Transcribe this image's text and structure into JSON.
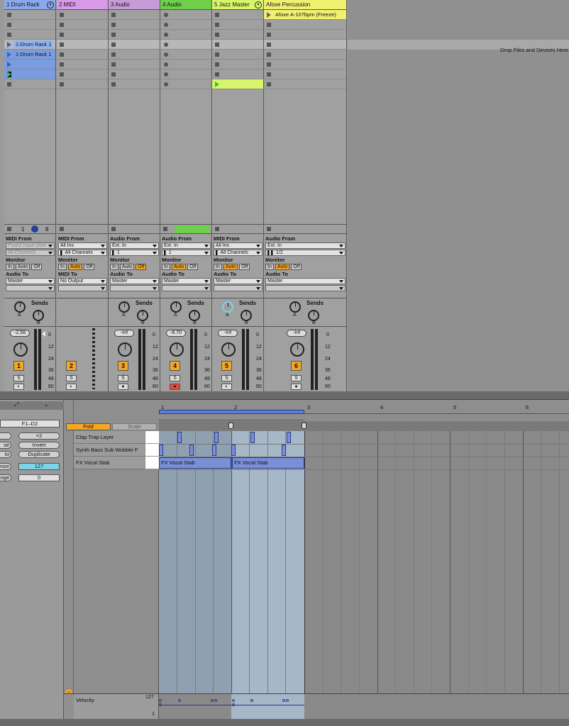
{
  "colors": {
    "drum_rack": "#8aa8ec",
    "midi": "#d69ae8",
    "audio3": "#c79ad8",
    "audio4": "#6fcf4a",
    "jazz": "#d8f56a",
    "afoxe": "#f0f070",
    "clip_selected": "#8fb3f0",
    "orange": "#f5a623",
    "record_red": "#e8473a"
  },
  "tracks": [
    {
      "name": "1 Drum Rack",
      "io_type": "MIDI From",
      "from": "Push2 Input (Ab▾",
      "channel": "All Channels",
      "monitor_active": "",
      "audio_to": "Master",
      "volume": "-2.58",
      "number": "1",
      "clips": [
        "1-Drum Rack 1",
        "1-Drum Rack 1"
      ],
      "bottom": [
        "1",
        "8"
      ]
    },
    {
      "name": "2 MIDI",
      "io_type": "MIDI From",
      "from": "All Ins",
      "channel": "All Channels",
      "monitor_active": "Auto",
      "audio_to_label": "MIDI To",
      "audio_to": "No Output",
      "volume": "",
      "number": "2"
    },
    {
      "name": "3 Audio",
      "io_type": "Audio From",
      "from": "Ext. In",
      "channel": "1",
      "monitor_active": "Off",
      "audio_to": "Master",
      "volume": "-Inf",
      "number": "3"
    },
    {
      "name": "4 Audio",
      "io_type": "Audio From",
      "from": "Ext. In",
      "channel": "1",
      "monitor_active": "Auto",
      "audio_to": "Master",
      "volume": "-8.70",
      "number": "4"
    },
    {
      "name": "5 Jazz Master",
      "io_type": "MIDI From",
      "from": "All Ins",
      "channel": "All Channels",
      "monitor_active": "Auto",
      "audio_to": "Master",
      "volume": "-Inf",
      "number": "5"
    },
    {
      "name": "Afoxe Percussion",
      "io_type": "Audio From",
      "from": "Ext. In",
      "channel": "1/2",
      "monitor_active": "Auto",
      "audio_to": "Master",
      "volume": "-Inf",
      "number": "6",
      "clips": [
        "Afoxe A-107bpm (Freeze)"
      ]
    }
  ],
  "labels": {
    "monitor": "Monitor",
    "audio_to": "Audio To",
    "sends": "Sends",
    "send_a": "A",
    "send_b": "B",
    "in": "In",
    "auto": "Auto",
    "off": "Off",
    "solo": "S",
    "drop_hint": "Drop Files and Devices Here"
  },
  "meter_scale": [
    "0",
    "12",
    "24",
    "36",
    "48",
    "60"
  ],
  "clip_view": {
    "range": "F1–D2",
    "buttons": {
      "times2": "×2",
      "reverse": "se",
      "invert": "Invert",
      "legato": "to",
      "duplicate": "Duplicate",
      "humanize": "nize",
      "humanize_value": "127",
      "range": "ange",
      "range_value": "0"
    },
    "fold": "Fold",
    "scale": "Scale",
    "rows": [
      "Clap Trap Layer",
      "Synth Bass Sub Wobble F",
      "FX Vocal Stab"
    ],
    "ruler": [
      "1",
      "2",
      "3",
      "4",
      "5",
      "6"
    ],
    "notes_clip": "FX Vocal Stab",
    "velocity": "Velocity",
    "vel_max": "127",
    "vel_min": "1"
  }
}
